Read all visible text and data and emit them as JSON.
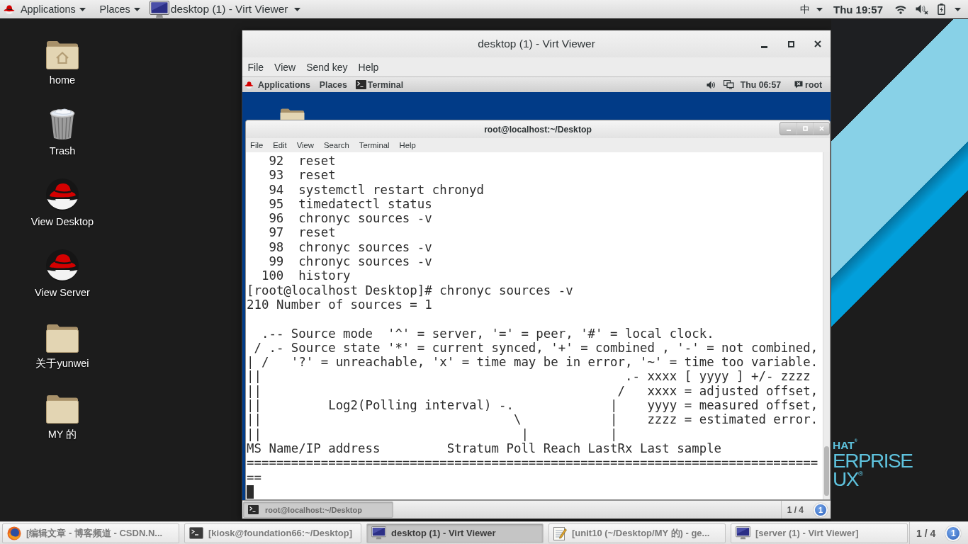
{
  "top_bar": {
    "applications": "Applications",
    "places": "Places",
    "window": "desktop (1) - Virt Viewer",
    "input_method": "中",
    "clock": "Thu 19:57",
    "volume_muted": true,
    "battery_charging": true
  },
  "desktop_icons": [
    {
      "kind": "home",
      "label": "home"
    },
    {
      "kind": "trash",
      "label": "Trash"
    },
    {
      "kind": "hat",
      "label": "View Desktop"
    },
    {
      "kind": "hat",
      "label": "View Server"
    },
    {
      "kind": "folder",
      "label": "关于yunwei"
    },
    {
      "kind": "folder",
      "label": "MY 的"
    }
  ],
  "viewer_window": {
    "title": "desktop (1) - Virt Viewer",
    "menu": [
      "File",
      "View",
      "Send key",
      "Help"
    ],
    "guest_top_bar": {
      "applications": "Applications",
      "places": "Places",
      "window": "Terminal",
      "clock": "Thu 06:57",
      "user": "root"
    },
    "terminal": {
      "title": "root@localhost:~/Desktop",
      "menu": [
        "File",
        "Edit",
        "View",
        "Search",
        "Terminal",
        "Help"
      ],
      "history": [
        {
          "number": "92",
          "command": "reset"
        },
        {
          "number": "93",
          "command": "reset"
        },
        {
          "number": "94",
          "command": "systemctl restart chronyd"
        },
        {
          "number": "95",
          "command": "timedatectl status"
        },
        {
          "number": "96",
          "command": "chronyc sources -v"
        },
        {
          "number": "97",
          "command": "reset"
        },
        {
          "number": "98",
          "command": "chronyc sources -v"
        },
        {
          "number": "99",
          "command": "chronyc sources -v"
        },
        {
          "number": "100",
          "command": "history"
        }
      ],
      "output_blocks": [
        [
          "[root@localhost Desktop]# chronyc sources -v",
          "210 Number of sources = 1"
        ],
        [
          "  .-- Source mode  '^' = server, '=' = peer, '#' = local clock.",
          " / .- Source state '*' = current synced, '+' = combined , '-' = not combined,",
          "| /   '?' = unreachable, 'x' = time may be in error, '~' = time too variable.",
          "||                                                 .- xxxx [ yyyy ] +/- zzzz",
          "||                                                /   xxxx = adjusted offset,",
          "||         Log2(Polling interval) -.             |    yyyy = measured offset,",
          "||                                  \\            |    zzzz = estimated error.",
          "||                                   |           |",
          "MS Name/IP address         Stratum Poll Reach LastRx Last sample",
          "=============================================================================",
          "=="
        ]
      ]
    },
    "guest_bottom_bar": {
      "task": {
        "label": "root@localhost:~/Desktop",
        "selected": true
      },
      "workspace": "1 / 4",
      "notifications": "1"
    }
  },
  "wallpaper_logo": [
    "HAT$^{®}$",
    "ERPRISE",
    "UX$^{®}$"
  ],
  "taskbar": {
    "items": [
      {
        "kind": "browser",
        "label": "[编辑文章 - 博客频道 - CSDN.N...",
        "selected": false
      },
      {
        "kind": "terminal",
        "label": "[kiosk@foundation66:~/Desktop]",
        "selected": false
      },
      {
        "kind": "viewer",
        "label": "desktop (1) - Virt Viewer",
        "selected": true
      },
      {
        "kind": "editor",
        "label": "[unit10 (~/Desktop/MY 的) - ge...",
        "selected": false
      },
      {
        "kind": "viewer",
        "label": "[server (1) - Virt Viewer]",
        "selected": false
      }
    ],
    "workspace": "1 / 4",
    "notifications": "1"
  }
}
